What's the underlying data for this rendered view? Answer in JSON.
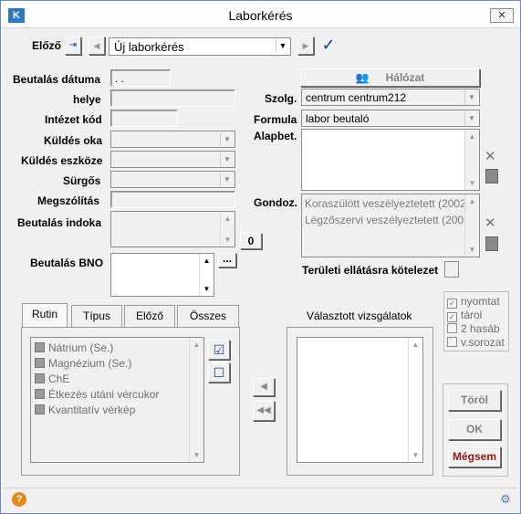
{
  "window": {
    "title": "Laborkérés",
    "close": "✕"
  },
  "toolbar": {
    "prev_label": "Előző",
    "request_value": "Új laborkérés"
  },
  "form": {
    "beutalas_datuma": {
      "label": "Beutalás dátuma",
      "value": ". ."
    },
    "helye": {
      "label": "helye",
      "value": ""
    },
    "intezet_kod": {
      "label": "Intézet kód",
      "value": ""
    },
    "kuldes_oka": {
      "label": "Küldés oka",
      "value": ""
    },
    "kuldes_eszkoze": {
      "label": "Küldés eszköze",
      "value": ""
    },
    "surgos": {
      "label": "Sürgős",
      "value": ""
    },
    "megszolitas": {
      "label": "Megszólítás",
      "value": ""
    },
    "beutalas_indoka": {
      "label": "Beutalás indoka",
      "counter": "0"
    },
    "beutalas_bno": {
      "label": "Beutalás BNO",
      "more": "..."
    }
  },
  "right": {
    "halozat_label": "Hálózat",
    "szolg": {
      "label": "Szolg.",
      "value": "centrum centrum212"
    },
    "formula": {
      "label": "Formula",
      "value": "labor beutaló"
    },
    "alapbet": {
      "label": "Alapbet."
    },
    "gondoz": {
      "label": "Gondoz.",
      "items": [
        "Koraszülött veszélyeztetett (2002",
        "Légzőszervi veszélyeztetett (2006"
      ]
    },
    "teruleti_label": "Területi ellátásra kötelezet"
  },
  "tabs": [
    "Rutin",
    "Típus",
    "Előző",
    "Összes"
  ],
  "tests": [
    "Nátrium (Se.)",
    "Magnézium (Se.)",
    "ChE",
    "Étkezés utáni vércukor",
    "Kvantitatív vérkép"
  ],
  "selected_title": "Választott vizsgálatok",
  "options": [
    {
      "label": "nyomtat",
      "checked": true
    },
    {
      "label": "tárol",
      "checked": true
    },
    {
      "label": "2 hasáb",
      "checked": false
    },
    {
      "label": "v.sorozat",
      "checked": false
    }
  ],
  "buttons": {
    "torol": "Töröl",
    "ok": "OK",
    "megsem": "Mégsem"
  },
  "colors": {
    "megsem_text": "#8b1a1a",
    "title_bg": "#ffffff"
  }
}
